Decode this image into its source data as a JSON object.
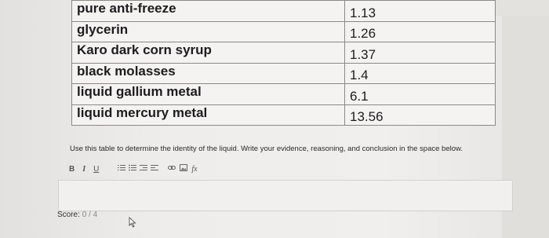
{
  "table": {
    "rows": [
      {
        "substance": "pure anti-freeze",
        "density": "1.13"
      },
      {
        "substance": "glycerin",
        "density": "1.26"
      },
      {
        "substance": "Karo dark corn syrup",
        "density": "1.37"
      },
      {
        "substance": "black molasses",
        "density": "1.4"
      },
      {
        "substance": "liquid gallium metal",
        "density": "6.1"
      },
      {
        "substance": "liquid mercury metal",
        "density": "13.56"
      }
    ]
  },
  "instructions": "Use this table to determine the identity of the liquid. Write your evidence, reasoning, and conclusion in the space below.",
  "toolbar": {
    "bold": "B",
    "italic": "I",
    "underline": "U",
    "fx": "fx"
  },
  "editor": {
    "value": ""
  },
  "score": {
    "label": "Score:",
    "value": "0 / 4"
  },
  "icons": [
    "bold-icon",
    "italic-icon",
    "underline-icon",
    "ordered-list-icon",
    "unordered-list-icon",
    "outdent-icon",
    "indent-icon",
    "link-icon",
    "image-icon",
    "formula-icon",
    "mouse-cursor-icon"
  ]
}
